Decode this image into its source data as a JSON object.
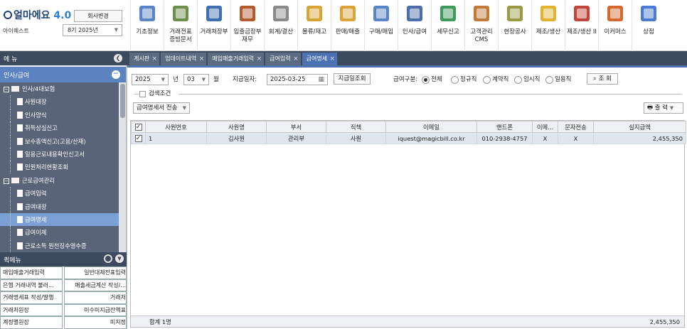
{
  "header": {
    "logo_text": "얼마에요",
    "logo_version": "4.0",
    "company_name": "아이퀘스트",
    "change_company_label": "회사변경",
    "period": "8기 2025년"
  },
  "top_menu": [
    {
      "label": "기초정보",
      "icon": "base-info-icon",
      "color": "#5a86c8"
    },
    {
      "label": "거래전표\n증빙문서",
      "icon": "voucher-icon",
      "color": "#6e8e4e"
    },
    {
      "label": "거래처장부",
      "icon": "ledger-icon",
      "color": "#3f6fb0"
    },
    {
      "label": "입출금장부\n재무",
      "icon": "cash-book-icon",
      "color": "#b05c2e"
    },
    {
      "label": "회계/결산",
      "icon": "accounting-icon",
      "color": "#8a8a8a"
    },
    {
      "label": "물류/재고",
      "icon": "logistics-icon",
      "color": "#d6a535"
    },
    {
      "label": "판매/매출",
      "icon": "sales-icon",
      "color": "#d9a43a"
    },
    {
      "label": "구매/매입",
      "icon": "purchase-icon",
      "color": "#5a86c8"
    },
    {
      "label": "인사/급여",
      "icon": "hr-icon",
      "color": "#4b6ea8"
    },
    {
      "label": "세무신고",
      "icon": "tax-icon",
      "color": "#3e9a5a"
    },
    {
      "label": "고객관리\nCMS",
      "icon": "crm-icon",
      "color": "#c07a3a"
    },
    {
      "label": "현장공사",
      "icon": "construction-icon",
      "color": "#9a9a44"
    },
    {
      "label": "제조/생산",
      "icon": "manufacturing-icon",
      "color": "#e2b232"
    },
    {
      "label": "제조/생산 II",
      "icon": "factory-icon",
      "color": "#c0453a"
    },
    {
      "label": "이커머스",
      "icon": "ecommerce-icon",
      "color": "#d36a2f"
    },
    {
      "label": "상점",
      "icon": "store-icon",
      "color": "#4a7bd0"
    }
  ],
  "sidebar": {
    "title": "메 뉴",
    "category": "인사/급여",
    "items": [
      {
        "label": "인사/4대보험",
        "type": "folder"
      },
      {
        "label": "사원대장",
        "type": "leaf"
      },
      {
        "label": "인사양식",
        "type": "leaf"
      },
      {
        "label": "취득상실신고",
        "type": "leaf"
      },
      {
        "label": "보수총액신고(고용/산재)",
        "type": "leaf"
      },
      {
        "label": "일용근로내용확인신고서",
        "type": "leaf"
      },
      {
        "label": "민원처리현황조회",
        "type": "leaf"
      },
      {
        "label": "근로급여관리",
        "type": "folder"
      },
      {
        "label": "급여입력",
        "type": "leaf"
      },
      {
        "label": "급여대장",
        "type": "leaf"
      },
      {
        "label": "급여명세",
        "type": "leaf",
        "active": true
      },
      {
        "label": "급여이체",
        "type": "leaf"
      },
      {
        "label": "근로소득 원천징수영수증",
        "type": "leaf"
      }
    ]
  },
  "quick_menu": {
    "title": "퀵메뉴",
    "items": [
      [
        "매입매출거래입력",
        "일반대체전표입력"
      ],
      [
        "은행 거래내역 불러...",
        "매출세금계산 작성/..."
      ],
      [
        "거래명세표 작성/발행",
        "거래처"
      ],
      [
        "거래처원장",
        "미수미지급잔액표"
      ],
      [
        "계정별원장",
        "미지정"
      ]
    ]
  },
  "tabs": [
    {
      "label": "게시판",
      "active": false
    },
    {
      "label": "업데이트내역",
      "active": false
    },
    {
      "label": "매입매출거래입력",
      "active": false
    },
    {
      "label": "급여입력",
      "active": false
    },
    {
      "label": "급여명세",
      "active": true
    }
  ],
  "filters": {
    "year": "2025",
    "year_suffix": "년",
    "month": "03",
    "month_suffix": "월",
    "pay_date_label": "지급일자:",
    "pay_date": "2025-03-25",
    "pay_date_query_label": "지급일조회",
    "pay_type_label": "급여구분:",
    "pay_types": [
      {
        "label": "전체",
        "checked": true
      },
      {
        "label": "정규직",
        "checked": false
      },
      {
        "label": "계약직",
        "checked": false
      },
      {
        "label": "임시직",
        "checked": false
      },
      {
        "label": "일용직",
        "checked": false
      }
    ],
    "search_label": "조 회",
    "search_condition_label": "검색조건",
    "send_dropdown": "급여명세서 전송",
    "print_label": "출 력"
  },
  "grid": {
    "columns": [
      "사원번호",
      "사원명",
      "부서",
      "직책",
      "이메일",
      "핸드폰",
      "이메...",
      "문자전송",
      "실지급액"
    ],
    "rows": [
      {
        "checked": true,
        "no": "1",
        "name": "김사원",
        "dept": "관리부",
        "position": "사원",
        "email": "iquest@magicbill.co.kr",
        "phone": "010-2938-4757",
        "email_sent": "X",
        "sms_sent": "X",
        "amount": "2,455,350"
      }
    ],
    "footer_label": "합계 1명",
    "footer_total": "2,455,350"
  }
}
